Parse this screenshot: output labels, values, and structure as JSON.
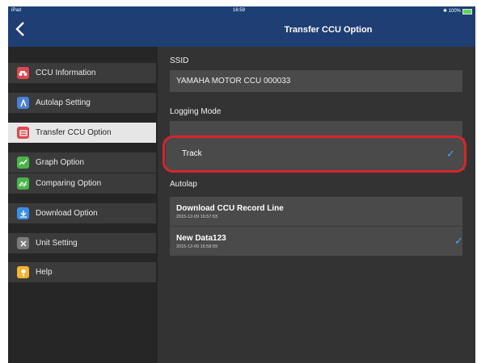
{
  "status_bar": {
    "device": "iPad",
    "time": "16:59",
    "battery": "✱ 100%"
  },
  "nav": {
    "back_icon": "chevron-left-icon",
    "title": "Transfer CCU Option"
  },
  "sidebar": {
    "items": [
      {
        "label": "CCU Information",
        "icon": "motorcycle-icon",
        "color": "#e0474f"
      },
      {
        "label": "Autolap Setting",
        "icon": "autolap-icon",
        "color": "#4a7fd6"
      },
      {
        "label": "Transfer CCU Option",
        "icon": "transfer-icon",
        "color": "#e0474f",
        "active": true
      },
      {
        "label": "Graph Option",
        "icon": "graph-icon",
        "color": "#4bb34b"
      },
      {
        "label": "Comparing Option",
        "icon": "compare-icon",
        "color": "#4bb34b"
      },
      {
        "label": "Download Option",
        "icon": "download-icon",
        "color": "#3a8ee6"
      },
      {
        "label": "Unit Setting",
        "icon": "unit-icon",
        "color": "#7b7b7b"
      },
      {
        "label": "Help",
        "icon": "help-icon",
        "color": "#f2b531"
      }
    ]
  },
  "main": {
    "ssid_label": "SSID",
    "ssid_value": "YAMAHA MOTOR CCU 000033",
    "logging_mode_label": "Logging Mode",
    "logging_mode_selected": "Track",
    "autolap_label": "Autolap",
    "records": [
      {
        "name": "Download CCU Record Line",
        "date": "2015-12-09 16:57:03",
        "checked": false
      },
      {
        "name": "New Data123",
        "date": "2015-12-09 16:58:59",
        "checked": true
      }
    ]
  },
  "colors": {
    "accent": "#4aa3ff",
    "highlight": "#d6252b",
    "nav": "#1f3e73"
  }
}
